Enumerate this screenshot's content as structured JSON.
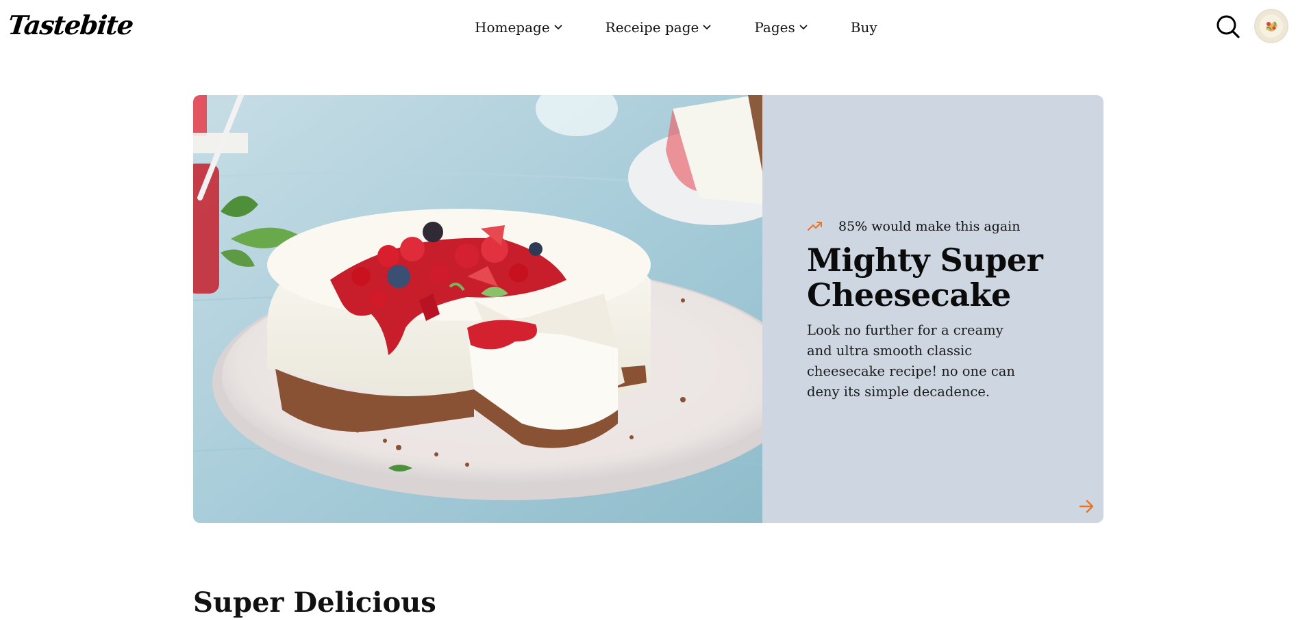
{
  "header": {
    "logo_text": "Tastebite",
    "nav": [
      {
        "label": "Homepage",
        "has_dropdown": true
      },
      {
        "label": "Receipe page",
        "has_dropdown": true
      },
      {
        "label": "Pages",
        "has_dropdown": true
      },
      {
        "label": "Buy",
        "has_dropdown": false
      }
    ],
    "search_icon": "search-icon",
    "avatar_icon": "user-avatar"
  },
  "hero": {
    "trend_icon": "trending-up-icon",
    "rating_text": "85% would make this again",
    "title": "Mighty Super Cheesecake",
    "description": "Look no further for a creamy and ultra smooth classic cheesecake recipe! no one can deny its simple decadence.",
    "arrow_icon": "arrow-right-icon",
    "panel_color": "#cdd6e1",
    "accent_color": "#e8742a"
  },
  "section": {
    "heading": "Super Delicious"
  }
}
